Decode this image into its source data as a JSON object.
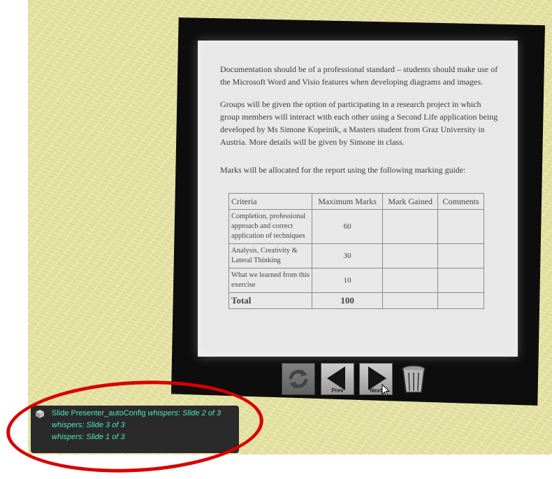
{
  "slide": {
    "paragraph1": "Documentation should be of a professional standard – students should make use of the Microsoft Word and Visio features when developing diagrams and images.",
    "paragraph2": "Groups will be given the option of participating in a research project in which group members will interact with each other using a Second Life application being developed by Ms Simone Kopeinik, a Masters student from Graz University in Austria. More details will be given by Simone in class.",
    "paragraph3": "Marks will be allocated for the report using the following marking guide:",
    "table": {
      "headers": [
        "Criteria",
        "Maximum Marks",
        "Mark Gained",
        "Comments"
      ],
      "rows": [
        {
          "criteria": "Completion, professional approach and correct application of techniques",
          "max": "60"
        },
        {
          "criteria": "Analysis, Creativity & Lateral Thinking",
          "max": "30"
        },
        {
          "criteria": "What we learned from this exercise",
          "max": "10"
        }
      ],
      "total_label": "Total",
      "total_value": "100"
    }
  },
  "controls": {
    "prev_label": "Prev",
    "next_label": "Next",
    "icons": [
      "refresh-icon",
      "prev-arrow-icon",
      "next-arrow-icon",
      "trash-icon"
    ]
  },
  "chat": {
    "sender": "Slide Presenter_autoConfig",
    "lines": [
      {
        "verb": "whispers:",
        "text": "Slide 2 of 3"
      },
      {
        "verb": "whispers:",
        "text": "Slide 3 of 3"
      },
      {
        "verb": "whispers:",
        "text": "Slide 1 of 3"
      }
    ],
    "text_color": "#4fe3c7"
  },
  "colors": {
    "wall": "#e6e3a6",
    "frame": "#0d0d0d",
    "highlight": "#d90000"
  }
}
